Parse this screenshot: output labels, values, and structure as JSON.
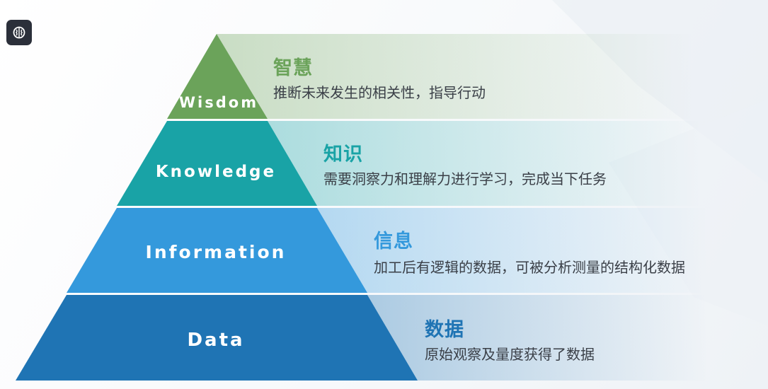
{
  "app_icon": "brain-icon",
  "colors": {
    "wisdom": "#6ba35a",
    "knowledge": "#19a3a6",
    "information": "#3499dc",
    "data": "#1f74b4"
  },
  "tiers": [
    {
      "key": "wisdom",
      "en": "Wisdom",
      "title": "智慧",
      "desc": "推断未来发生的相关性，指导行动"
    },
    {
      "key": "knowledge",
      "en": "Knowledge",
      "title": "知识",
      "desc": "需要洞察力和理解力进行学习，完成当下任务"
    },
    {
      "key": "information",
      "en": "Information",
      "title": "信息",
      "desc": "加工后有逻辑的数据，可被分析测量的结构化数据"
    },
    {
      "key": "data",
      "en": "Data",
      "title": "数据",
      "desc": "原始观察及量度获得了数据"
    }
  ]
}
